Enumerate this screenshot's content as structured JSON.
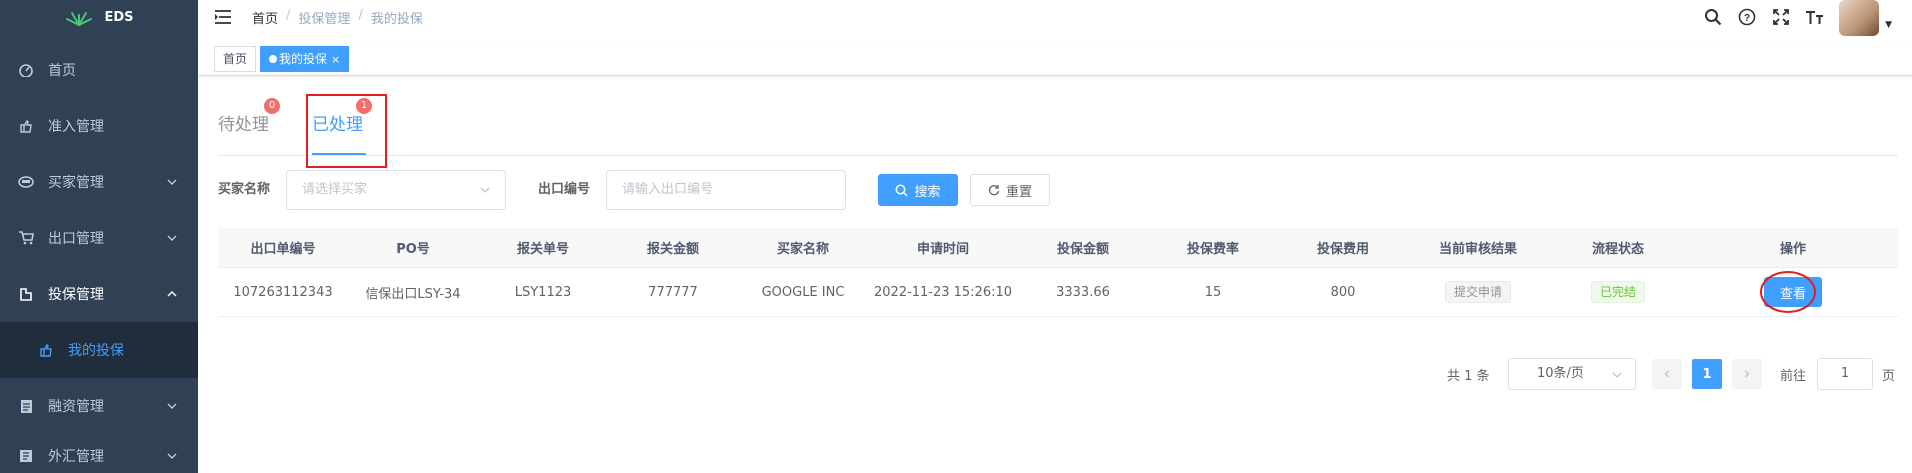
{
  "app": {
    "logo_text": "EDS"
  },
  "sidebar": {
    "items": [
      {
        "label": "首页",
        "icon": "dashboard-icon"
      },
      {
        "label": "准入管理",
        "icon": "hand-icon"
      },
      {
        "label": "买家管理",
        "icon": "buyer-icon"
      },
      {
        "label": "出口管理",
        "icon": "cart-icon"
      },
      {
        "label": "投保管理",
        "icon": "insurance-icon"
      },
      {
        "label": "我的投保",
        "icon": "hand-icon"
      },
      {
        "label": "融资管理",
        "icon": "document-icon"
      },
      {
        "label": "外汇管理",
        "icon": "exchange-icon"
      }
    ]
  },
  "header": {
    "breadcrumb": {
      "home": "首页",
      "sep": "/",
      "level1": "投保管理",
      "level2": "我的投保"
    }
  },
  "tags": {
    "home": "首页",
    "current": "我的投保",
    "close": "×"
  },
  "tabs": {
    "pending": {
      "label": "待处理",
      "count": "0"
    },
    "processed": {
      "label": "已处理",
      "count": "1"
    }
  },
  "filters": {
    "buyer_label": "买家名称",
    "buyer_placeholder": "请选择买家",
    "export_label": "出口编号",
    "export_placeholder": "请输入出口编号",
    "search_button": "搜索",
    "reset_button": "重置"
  },
  "table": {
    "columns": [
      "出口单编号",
      "PO号",
      "报关单号",
      "报关金额",
      "买家名称",
      "申请时间",
      "投保金额",
      "投保费率",
      "投保费用",
      "当前审核结果",
      "流程状态",
      "操作"
    ],
    "rows": [
      {
        "export_no": "107263112343",
        "po": "信保出口LSY-34",
        "customs_no": "LSY1123",
        "customs_amount": "777777",
        "buyer": "GOOGLE INC",
        "apply_time": "2022-11-23 15:26:10",
        "insured_amount": "3333.66",
        "rate": "15",
        "fee": "800",
        "review_result": "提交申请",
        "flow_status": "已完结",
        "action": "查看"
      }
    ]
  },
  "pagination": {
    "total_text": "共 1 条",
    "page_size": "10条/页",
    "current_page": "1",
    "goto_label": "前往",
    "goto_value": "1",
    "page_suffix": "页"
  },
  "colors": {
    "primary": "#409eff",
    "sidebar_bg": "#304156",
    "annotation": "#e02020"
  }
}
